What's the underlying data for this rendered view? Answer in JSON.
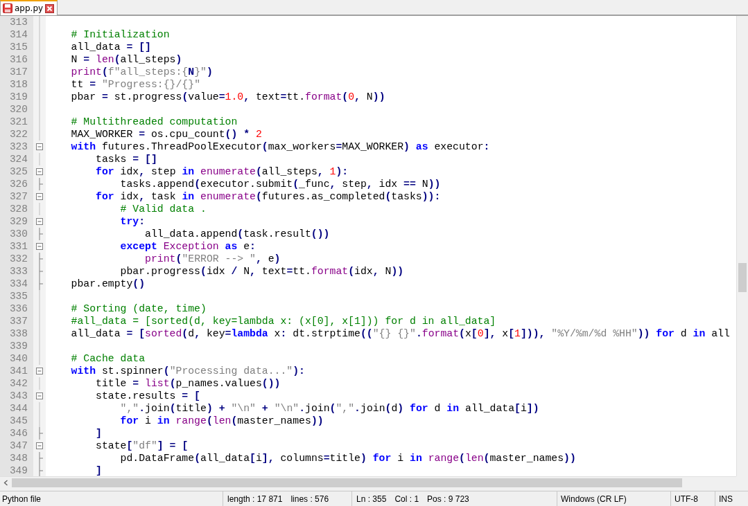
{
  "tabs": [
    {
      "label": "app.py",
      "selected": true
    }
  ],
  "editor": {
    "lines": [
      {
        "number": "313",
        "kind": "body"
      },
      {
        "number": "314",
        "kind": "body",
        "tokens": [
          {
            "kind": "comment",
            "text": "    # Initialization"
          }
        ]
      },
      {
        "number": "315",
        "kind": "body",
        "tokens": [
          {
            "kind": "plain",
            "text": "    all_data "
          },
          {
            "kind": "op",
            "text": "= []"
          }
        ]
      },
      {
        "number": "316",
        "kind": "body",
        "tokens": [
          {
            "kind": "plain",
            "text": "    N "
          },
          {
            "kind": "op",
            "text": "= "
          },
          {
            "kind": "fn",
            "text": "len"
          },
          {
            "kind": "op",
            "text": "("
          },
          {
            "kind": "plain",
            "text": "all_steps"
          },
          {
            "kind": "op",
            "text": ")"
          }
        ]
      },
      {
        "number": "317",
        "kind": "body",
        "tokens": [
          {
            "kind": "fn",
            "text": "    print"
          },
          {
            "kind": "op",
            "text": "("
          },
          {
            "kind": "str",
            "text": "f\"all_steps:{"
          },
          {
            "kind": "op",
            "text": "N"
          },
          {
            "kind": "str",
            "text": "}\""
          },
          {
            "kind": "op",
            "text": ")"
          }
        ]
      },
      {
        "number": "318",
        "kind": "body",
        "tokens": [
          {
            "kind": "plain",
            "text": "    tt "
          },
          {
            "kind": "op",
            "text": "= "
          },
          {
            "kind": "str",
            "text": "\"Progress:{}/{}\""
          }
        ]
      },
      {
        "number": "319",
        "kind": "body",
        "tokens": [
          {
            "kind": "plain",
            "text": "    pbar "
          },
          {
            "kind": "op",
            "text": "="
          },
          {
            "kind": "plain",
            "text": " st.progress"
          },
          {
            "kind": "op",
            "text": "("
          },
          {
            "kind": "plain",
            "text": "value"
          },
          {
            "kind": "op",
            "text": "="
          },
          {
            "kind": "num",
            "text": "1.0"
          },
          {
            "kind": "op",
            "text": ","
          },
          {
            "kind": "plain",
            "text": " text"
          },
          {
            "kind": "op",
            "text": "="
          },
          {
            "kind": "plain",
            "text": "tt."
          },
          {
            "kind": "fn",
            "text": "format"
          },
          {
            "kind": "op",
            "text": "("
          },
          {
            "kind": "num",
            "text": "0"
          },
          {
            "kind": "op",
            "text": ","
          },
          {
            "kind": "plain",
            "text": " N"
          },
          {
            "kind": "op",
            "text": "))"
          }
        ]
      },
      {
        "number": "320",
        "kind": "body"
      },
      {
        "number": "321",
        "kind": "body",
        "tokens": [
          {
            "kind": "comment",
            "text": "    # Multithreaded computation"
          }
        ]
      },
      {
        "number": "322",
        "kind": "body",
        "tokens": [
          {
            "kind": "plain",
            "text": "    MAX_WORKER "
          },
          {
            "kind": "op",
            "text": "="
          },
          {
            "kind": "plain",
            "text": " os.cpu_count"
          },
          {
            "kind": "op",
            "text": "() * "
          },
          {
            "kind": "num",
            "text": "2"
          }
        ]
      },
      {
        "number": "323",
        "kind": "start",
        "tokens": [
          {
            "kind": "kw",
            "text": "    with"
          },
          {
            "kind": "plain",
            "text": " futures.ThreadPoolExecutor"
          },
          {
            "kind": "op",
            "text": "("
          },
          {
            "kind": "plain",
            "text": "max_workers"
          },
          {
            "kind": "op",
            "text": "="
          },
          {
            "kind": "plain",
            "text": "MAX_WORKER"
          },
          {
            "kind": "op",
            "text": ") "
          },
          {
            "kind": "kw",
            "text": "as"
          },
          {
            "kind": "plain",
            "text": " executor"
          },
          {
            "kind": "op",
            "text": ":"
          }
        ]
      },
      {
        "number": "324",
        "kind": "body",
        "tokens": [
          {
            "kind": "plain",
            "text": "        tasks "
          },
          {
            "kind": "op",
            "text": "= []"
          }
        ]
      },
      {
        "number": "325",
        "kind": "start",
        "tokens": [
          {
            "kind": "kw",
            "text": "        for"
          },
          {
            "kind": "plain",
            "text": " idx"
          },
          {
            "kind": "op",
            "text": ","
          },
          {
            "kind": "plain",
            "text": " step "
          },
          {
            "kind": "kw",
            "text": "in "
          },
          {
            "kind": "fn",
            "text": "enumerate"
          },
          {
            "kind": "op",
            "text": "("
          },
          {
            "kind": "plain",
            "text": "all_steps"
          },
          {
            "kind": "op",
            "text": ", "
          },
          {
            "kind": "num",
            "text": "1"
          },
          {
            "kind": "op",
            "text": "):"
          }
        ]
      },
      {
        "number": "326",
        "kind": "end",
        "tokens": [
          {
            "kind": "plain",
            "text": "            tasks.append"
          },
          {
            "kind": "op",
            "text": "("
          },
          {
            "kind": "plain",
            "text": "executor.submit"
          },
          {
            "kind": "op",
            "text": "("
          },
          {
            "kind": "plain",
            "text": "_func"
          },
          {
            "kind": "op",
            "text": ","
          },
          {
            "kind": "plain",
            "text": " step"
          },
          {
            "kind": "op",
            "text": ","
          },
          {
            "kind": "plain",
            "text": " idx "
          },
          {
            "kind": "op",
            "text": "=="
          },
          {
            "kind": "plain",
            "text": " N"
          },
          {
            "kind": "op",
            "text": "))"
          }
        ]
      },
      {
        "number": "327",
        "kind": "start",
        "tokens": [
          {
            "kind": "kw",
            "text": "        for"
          },
          {
            "kind": "plain",
            "text": " idx"
          },
          {
            "kind": "op",
            "text": ","
          },
          {
            "kind": "plain",
            "text": " task "
          },
          {
            "kind": "kw",
            "text": "in "
          },
          {
            "kind": "fn",
            "text": "enumerate"
          },
          {
            "kind": "op",
            "text": "("
          },
          {
            "kind": "plain",
            "text": "futures.as_completed"
          },
          {
            "kind": "op",
            "text": "("
          },
          {
            "kind": "plain",
            "text": "tasks"
          },
          {
            "kind": "op",
            "text": ")):"
          }
        ]
      },
      {
        "number": "328",
        "kind": "body",
        "tokens": [
          {
            "kind": "comment",
            "text": "            # Valid data ."
          }
        ]
      },
      {
        "number": "329",
        "kind": "start",
        "tokens": [
          {
            "kind": "kw",
            "text": "            try"
          },
          {
            "kind": "op",
            "text": ":"
          }
        ]
      },
      {
        "number": "330",
        "kind": "end",
        "tokens": [
          {
            "kind": "plain",
            "text": "                all_data.append"
          },
          {
            "kind": "op",
            "text": "("
          },
          {
            "kind": "plain",
            "text": "task.result"
          },
          {
            "kind": "op",
            "text": "())"
          }
        ]
      },
      {
        "number": "331",
        "kind": "start",
        "tokens": [
          {
            "kind": "kw",
            "text": "            except "
          },
          {
            "kind": "fn",
            "text": "Exception"
          },
          {
            "kind": "kw",
            "text": " as"
          },
          {
            "kind": "plain",
            "text": " e"
          },
          {
            "kind": "op",
            "text": ":"
          }
        ]
      },
      {
        "number": "332",
        "kind": "end",
        "tokens": [
          {
            "kind": "fn",
            "text": "                print"
          },
          {
            "kind": "op",
            "text": "("
          },
          {
            "kind": "str",
            "text": "\"ERROR --> \""
          },
          {
            "kind": "op",
            "text": ","
          },
          {
            "kind": "plain",
            "text": " e"
          },
          {
            "kind": "op",
            "text": ")"
          }
        ]
      },
      {
        "number": "333",
        "kind": "end",
        "tokens": [
          {
            "kind": "plain",
            "text": "            pbar.progress"
          },
          {
            "kind": "op",
            "text": "("
          },
          {
            "kind": "plain",
            "text": "idx "
          },
          {
            "kind": "op",
            "text": "/"
          },
          {
            "kind": "plain",
            "text": " N"
          },
          {
            "kind": "op",
            "text": ","
          },
          {
            "kind": "plain",
            "text": " text"
          },
          {
            "kind": "op",
            "text": "="
          },
          {
            "kind": "plain",
            "text": "tt."
          },
          {
            "kind": "fn",
            "text": "format"
          },
          {
            "kind": "op",
            "text": "("
          },
          {
            "kind": "plain",
            "text": "idx"
          },
          {
            "kind": "op",
            "text": ","
          },
          {
            "kind": "plain",
            "text": " N"
          },
          {
            "kind": "op",
            "text": "))"
          }
        ]
      },
      {
        "number": "334",
        "kind": "end",
        "tokens": [
          {
            "kind": "plain",
            "text": "    pbar.empty"
          },
          {
            "kind": "op",
            "text": "()"
          }
        ]
      },
      {
        "number": "335",
        "kind": "body"
      },
      {
        "number": "336",
        "kind": "body",
        "tokens": [
          {
            "kind": "comment",
            "text": "    # Sorting (date, time)"
          }
        ]
      },
      {
        "number": "337",
        "kind": "body",
        "tokens": [
          {
            "kind": "comment",
            "text": "    #all_data = [sorted(d, key=lambda x: (x[0], x[1])) for d in all_data]"
          }
        ]
      },
      {
        "number": "338",
        "kind": "body",
        "tokens": [
          {
            "kind": "plain",
            "text": "    all_data "
          },
          {
            "kind": "op",
            "text": "= ["
          },
          {
            "kind": "fn",
            "text": "sorted"
          },
          {
            "kind": "op",
            "text": "("
          },
          {
            "kind": "plain",
            "text": "d"
          },
          {
            "kind": "op",
            "text": ","
          },
          {
            "kind": "plain",
            "text": " key"
          },
          {
            "kind": "op",
            "text": "="
          },
          {
            "kind": "kw",
            "text": "lambda"
          },
          {
            "kind": "plain",
            "text": " x"
          },
          {
            "kind": "op",
            "text": ":"
          },
          {
            "kind": "plain",
            "text": " dt.strptime"
          },
          {
            "kind": "op",
            "text": "(("
          },
          {
            "kind": "str",
            "text": "\"{} {}\""
          },
          {
            "kind": "op",
            "text": "."
          },
          {
            "kind": "fn",
            "text": "format"
          },
          {
            "kind": "op",
            "text": "("
          },
          {
            "kind": "plain",
            "text": "x"
          },
          {
            "kind": "op",
            "text": "["
          },
          {
            "kind": "num",
            "text": "0"
          },
          {
            "kind": "op",
            "text": "],"
          },
          {
            "kind": "plain",
            "text": " x"
          },
          {
            "kind": "op",
            "text": "["
          },
          {
            "kind": "num",
            "text": "1"
          },
          {
            "kind": "op",
            "text": "])), "
          },
          {
            "kind": "str",
            "text": "\"%Y/%m/%d %HH\""
          },
          {
            "kind": "op",
            "text": ")) "
          },
          {
            "kind": "kw",
            "text": "for"
          },
          {
            "kind": "plain",
            "text": " d "
          },
          {
            "kind": "kw",
            "text": "in"
          },
          {
            "kind": "plain",
            "text": " all"
          }
        ]
      },
      {
        "number": "339",
        "kind": "body"
      },
      {
        "number": "340",
        "kind": "body",
        "tokens": [
          {
            "kind": "comment",
            "text": "    # Cache data"
          }
        ]
      },
      {
        "number": "341",
        "kind": "start",
        "tokens": [
          {
            "kind": "kw",
            "text": "    with"
          },
          {
            "kind": "plain",
            "text": " st.spinner"
          },
          {
            "kind": "op",
            "text": "("
          },
          {
            "kind": "str",
            "text": "\"Processing data...\""
          },
          {
            "kind": "op",
            "text": "):"
          }
        ]
      },
      {
        "number": "342",
        "kind": "body",
        "tokens": [
          {
            "kind": "plain",
            "text": "        title "
          },
          {
            "kind": "op",
            "text": "= "
          },
          {
            "kind": "fn",
            "text": "list"
          },
          {
            "kind": "op",
            "text": "("
          },
          {
            "kind": "plain",
            "text": "p_names.values"
          },
          {
            "kind": "op",
            "text": "())"
          }
        ]
      },
      {
        "number": "343",
        "kind": "start",
        "tokens": [
          {
            "kind": "plain",
            "text": "        state.results "
          },
          {
            "kind": "op",
            "text": "= ["
          }
        ]
      },
      {
        "number": "344",
        "kind": "body",
        "tokens": [
          {
            "kind": "str",
            "text": "            \",\""
          },
          {
            "kind": "op",
            "text": "."
          },
          {
            "kind": "plain",
            "text": "join"
          },
          {
            "kind": "op",
            "text": "("
          },
          {
            "kind": "plain",
            "text": "title"
          },
          {
            "kind": "op",
            "text": ") + "
          },
          {
            "kind": "str",
            "text": "\"\\n\""
          },
          {
            "kind": "op",
            "text": " + "
          },
          {
            "kind": "str",
            "text": "\"\\n\""
          },
          {
            "kind": "op",
            "text": "."
          },
          {
            "kind": "plain",
            "text": "join"
          },
          {
            "kind": "op",
            "text": "("
          },
          {
            "kind": "str",
            "text": "\",\""
          },
          {
            "kind": "op",
            "text": "."
          },
          {
            "kind": "plain",
            "text": "join"
          },
          {
            "kind": "op",
            "text": "("
          },
          {
            "kind": "plain",
            "text": "d"
          },
          {
            "kind": "op",
            "text": ") "
          },
          {
            "kind": "kw",
            "text": "for"
          },
          {
            "kind": "plain",
            "text": " d "
          },
          {
            "kind": "kw",
            "text": "in"
          },
          {
            "kind": "plain",
            "text": " all_data"
          },
          {
            "kind": "op",
            "text": "["
          },
          {
            "kind": "plain",
            "text": "i"
          },
          {
            "kind": "op",
            "text": "])"
          }
        ]
      },
      {
        "number": "345",
        "kind": "body",
        "tokens": [
          {
            "kind": "kw",
            "text": "            for"
          },
          {
            "kind": "plain",
            "text": " i "
          },
          {
            "kind": "kw",
            "text": "in "
          },
          {
            "kind": "fn",
            "text": "range"
          },
          {
            "kind": "op",
            "text": "("
          },
          {
            "kind": "fn",
            "text": "len"
          },
          {
            "kind": "op",
            "text": "("
          },
          {
            "kind": "plain",
            "text": "master_names"
          },
          {
            "kind": "op",
            "text": "))"
          }
        ]
      },
      {
        "number": "346",
        "kind": "end",
        "tokens": [
          {
            "kind": "op",
            "text": "        ]"
          }
        ]
      },
      {
        "number": "347",
        "kind": "start",
        "tokens": [
          {
            "kind": "plain",
            "text": "        state"
          },
          {
            "kind": "op",
            "text": "["
          },
          {
            "kind": "str",
            "text": "\"df\""
          },
          {
            "kind": "op",
            "text": "] = ["
          }
        ]
      },
      {
        "number": "348",
        "kind": "end",
        "tokens": [
          {
            "kind": "plain",
            "text": "            pd.DataFrame"
          },
          {
            "kind": "op",
            "text": "("
          },
          {
            "kind": "plain",
            "text": "all_data"
          },
          {
            "kind": "op",
            "text": "["
          },
          {
            "kind": "plain",
            "text": "i"
          },
          {
            "kind": "op",
            "text": "],"
          },
          {
            "kind": "plain",
            "text": " columns"
          },
          {
            "kind": "op",
            "text": "="
          },
          {
            "kind": "plain",
            "text": "title"
          },
          {
            "kind": "op",
            "text": ") "
          },
          {
            "kind": "kw",
            "text": "for"
          },
          {
            "kind": "plain",
            "text": " i "
          },
          {
            "kind": "kw",
            "text": "in "
          },
          {
            "kind": "fn",
            "text": "range"
          },
          {
            "kind": "op",
            "text": "("
          },
          {
            "kind": "fn",
            "text": "len"
          },
          {
            "kind": "op",
            "text": "("
          },
          {
            "kind": "plain",
            "text": "master_names"
          },
          {
            "kind": "op",
            "text": "))"
          }
        ]
      },
      {
        "number": "349",
        "kind": "end",
        "tokens": [
          {
            "kind": "op",
            "text": "        ]"
          }
        ]
      }
    ]
  },
  "status_bar": {
    "file_type": "Python file",
    "length": "length : 17 871",
    "lines": "lines : 576",
    "ln": "Ln : 355",
    "col": "Col : 1",
    "pos": "Pos : 9 723",
    "eol": "Windows (CR LF)",
    "encoding": "UTF-8",
    "mode": "INS"
  }
}
